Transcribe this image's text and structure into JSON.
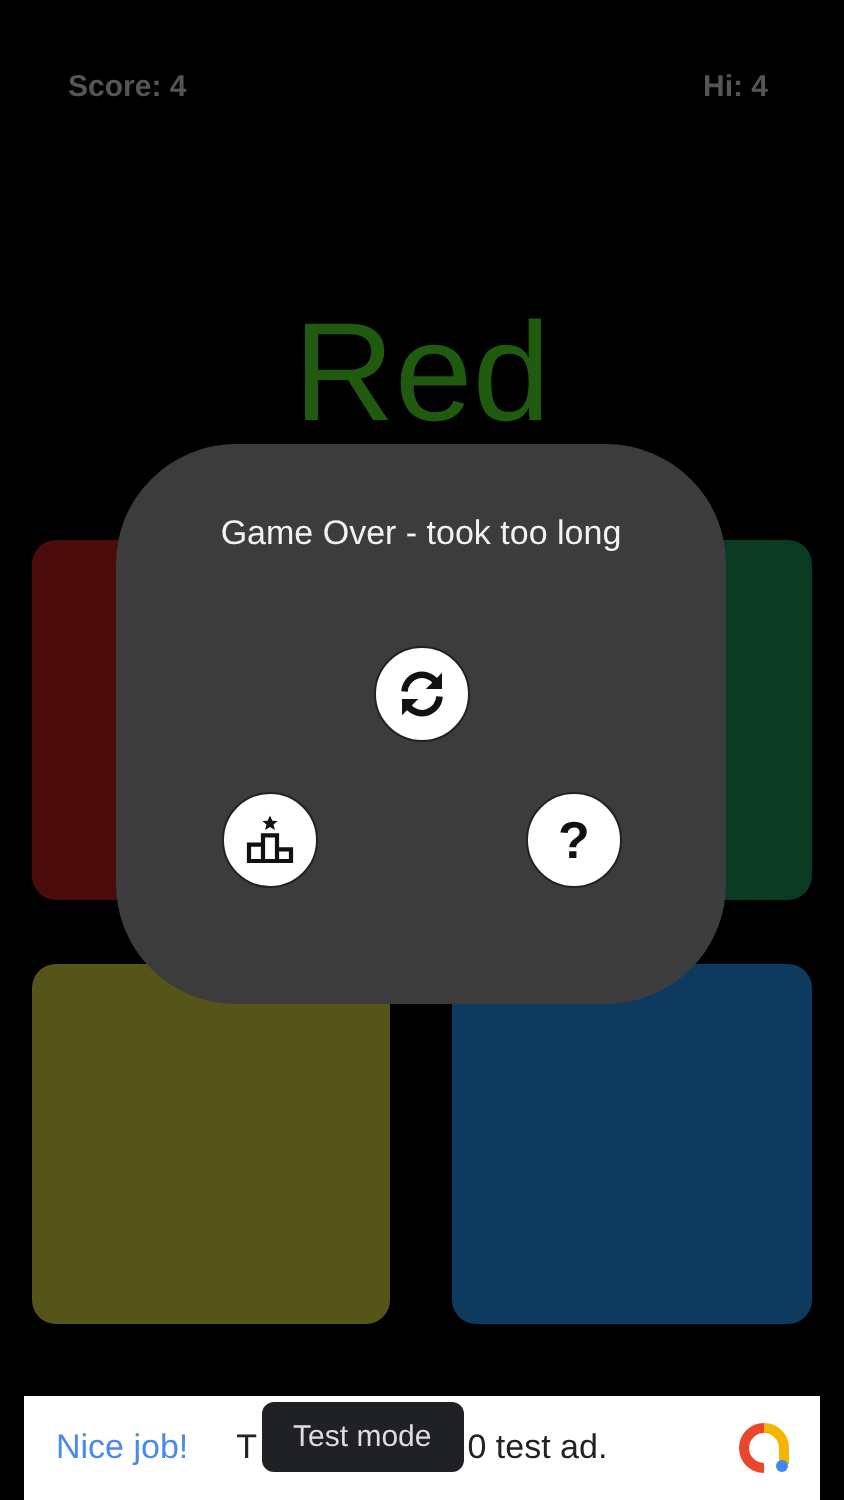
{
  "header": {
    "score": "Score: 4",
    "hi": "Hi: 4"
  },
  "word": "Red",
  "tiles": [
    {
      "color": "#4a0b0b"
    },
    {
      "color": "#0b3a22"
    },
    {
      "color": "#55551a"
    },
    {
      "color": "#0d3a5e"
    }
  ],
  "dialog": {
    "message": "Game Over - took too long",
    "buttons": [
      {
        "kind": "restart"
      },
      {
        "kind": "leaderboard"
      },
      {
        "kind": "help",
        "label": "?"
      }
    ]
  },
  "ad": {
    "headline": "Nice job!",
    "text_before": "T",
    "text_after": "0 test ad.",
    "tooltip": "Test mode"
  }
}
